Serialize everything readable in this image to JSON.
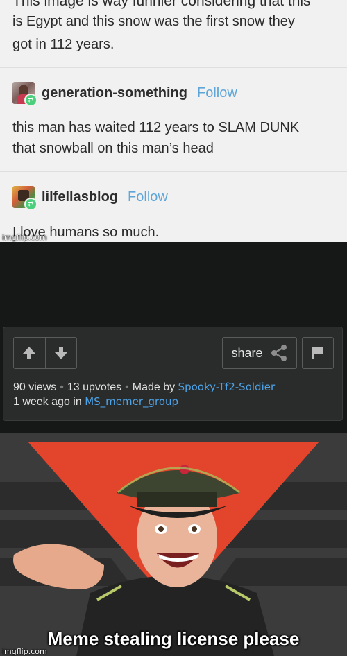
{
  "tumblr": {
    "cut_text": "This image is way funnier considering that this",
    "post_lines": [
      "is Egypt and this snow was the first snow they",
      "got in 112 years."
    ],
    "reblogs": [
      {
        "username": "generation-something",
        "follow": "Follow",
        "lines": [
          "this man has waited 112 years to SLAM DUNK",
          "that snowball on this man’s head"
        ]
      },
      {
        "username": "lilfellasblog",
        "follow": "Follow",
        "lines": [
          "I love humans so much."
        ]
      }
    ],
    "watermark": "imgflip.com"
  },
  "imgflip_card": {
    "upvote_icon": "arrow-up-icon",
    "downvote_icon": "arrow-down-icon",
    "share_label": "share",
    "share_icon": "share-icon",
    "flag_icon": "flag-icon",
    "views": "90 views",
    "upvotes": "13 upvotes",
    "made_by_prefix": "Made by",
    "author": "Spooky-Tf2-Soldier",
    "time_prefix": "1 week ago in",
    "stream": "MS_memer_group",
    "link_color": "#4da3e8"
  },
  "meme": {
    "caption": "Meme stealing license please",
    "watermark": "imgflip.com"
  }
}
